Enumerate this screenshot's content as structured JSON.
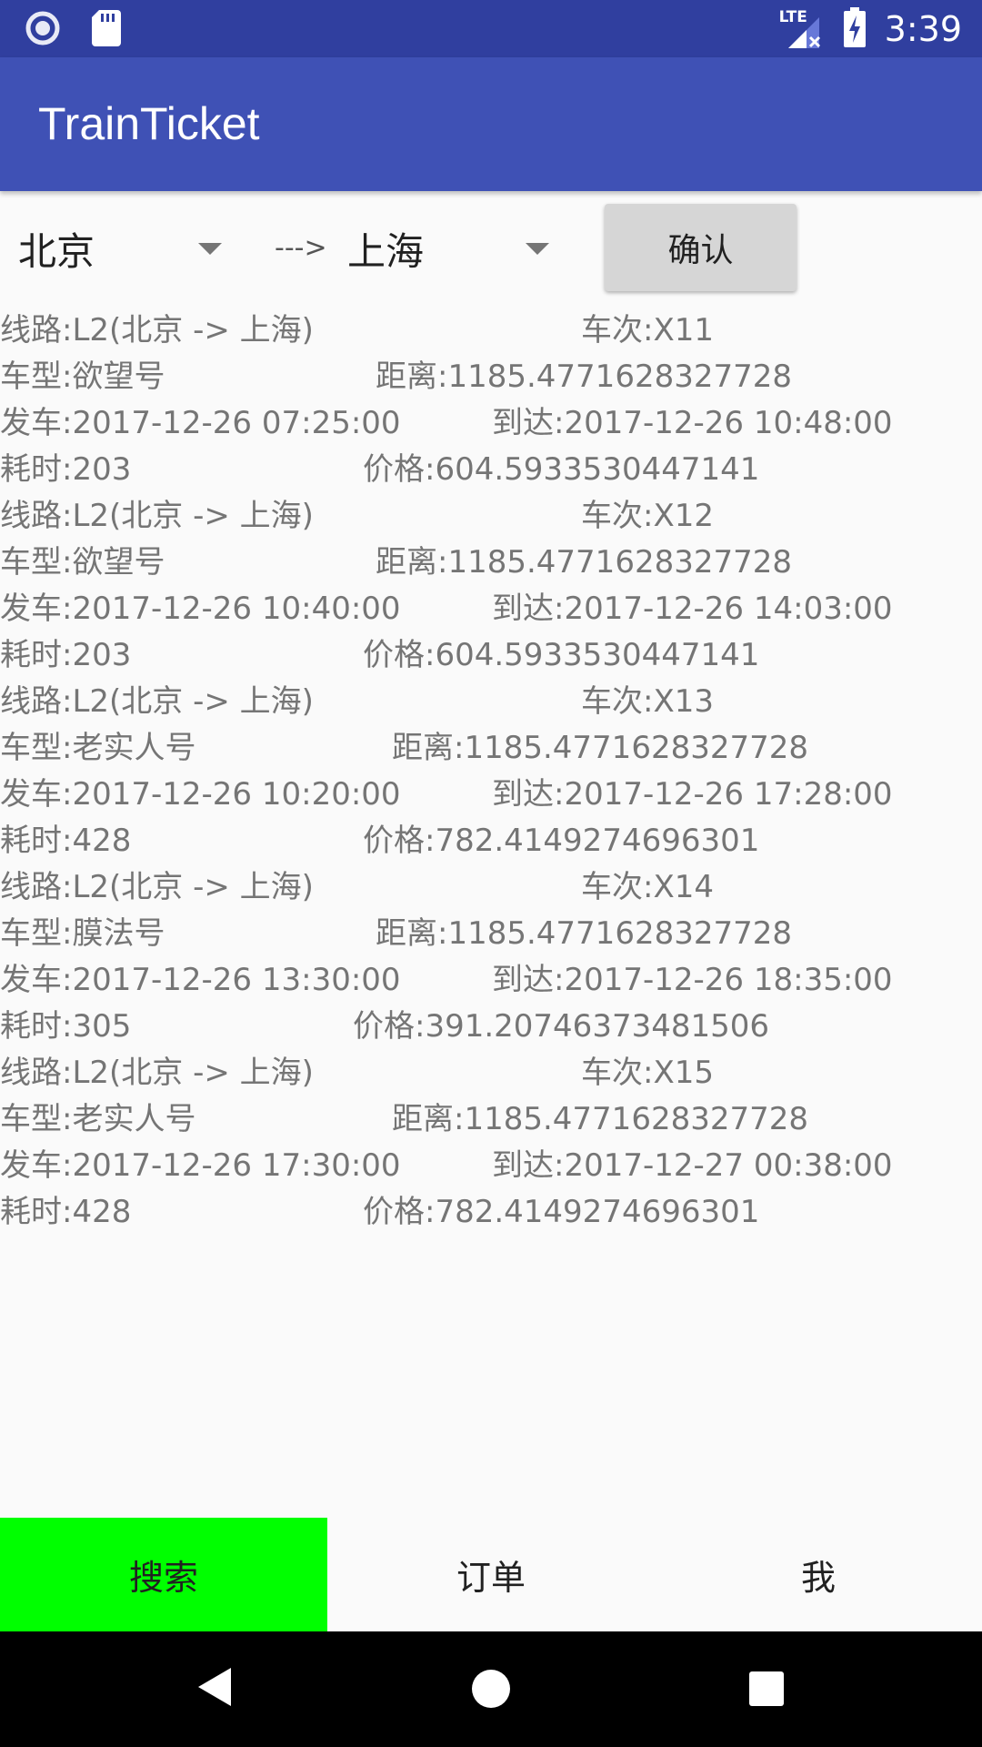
{
  "status_bar": {
    "time": "3:39",
    "network": "LTE",
    "colors": {
      "background": "#303f9f"
    }
  },
  "app_bar": {
    "title": "TrainTicket",
    "color": "#3f51b5"
  },
  "search": {
    "from": "北京",
    "separator": "--->",
    "to": "上海",
    "confirm_label": "确认"
  },
  "results": [
    {
      "route": "线路:L2(北京 -> 上海)",
      "train": "车次:X11",
      "type": "车型:欲望号",
      "distance": "距离:1185.4771628327728",
      "depart": "发车:2017-12-26 07:25:00",
      "arrive": "到达:2017-12-26 10:48:00",
      "duration": "耗时:203",
      "price": "价格:604.5933530447141"
    },
    {
      "route": "线路:L2(北京 -> 上海)",
      "train": "车次:X12",
      "type": "车型:欲望号",
      "distance": "距离:1185.4771628327728",
      "depart": "发车:2017-12-26 10:40:00",
      "arrive": "到达:2017-12-26 14:03:00",
      "duration": "耗时:203",
      "price": "价格:604.5933530447141"
    },
    {
      "route": "线路:L2(北京 -> 上海)",
      "train": "车次:X13",
      "type": "车型:老实人号",
      "distance": "距离:1185.4771628327728",
      "depart": "发车:2017-12-26 10:20:00",
      "arrive": "到达:2017-12-26 17:28:00",
      "duration": "耗时:428",
      "price": "价格:782.4149274696301"
    },
    {
      "route": "线路:L2(北京 -> 上海)",
      "train": "车次:X14",
      "type": "车型:膜法号",
      "distance": "距离:1185.4771628327728",
      "depart": "发车:2017-12-26 13:30:00",
      "arrive": "到达:2017-12-26 18:35:00",
      "duration": "耗时:305",
      "price": "价格:391.20746373481506"
    },
    {
      "route": "线路:L2(北京 -> 上海)",
      "train": "车次:X15",
      "type": "车型:老实人号",
      "distance": "距离:1185.4771628327728",
      "depart": "发车:2017-12-26 17:30:00",
      "arrive": "到达:2017-12-27 00:38:00",
      "duration": "耗时:428",
      "price": "价格:782.4149274696301"
    }
  ],
  "tabs": [
    {
      "label": "搜索",
      "active": true
    },
    {
      "label": "订单",
      "active": false
    },
    {
      "label": "我",
      "active": false
    }
  ],
  "colors": {
    "active_tab": "#00ff00",
    "text": "#757575"
  }
}
